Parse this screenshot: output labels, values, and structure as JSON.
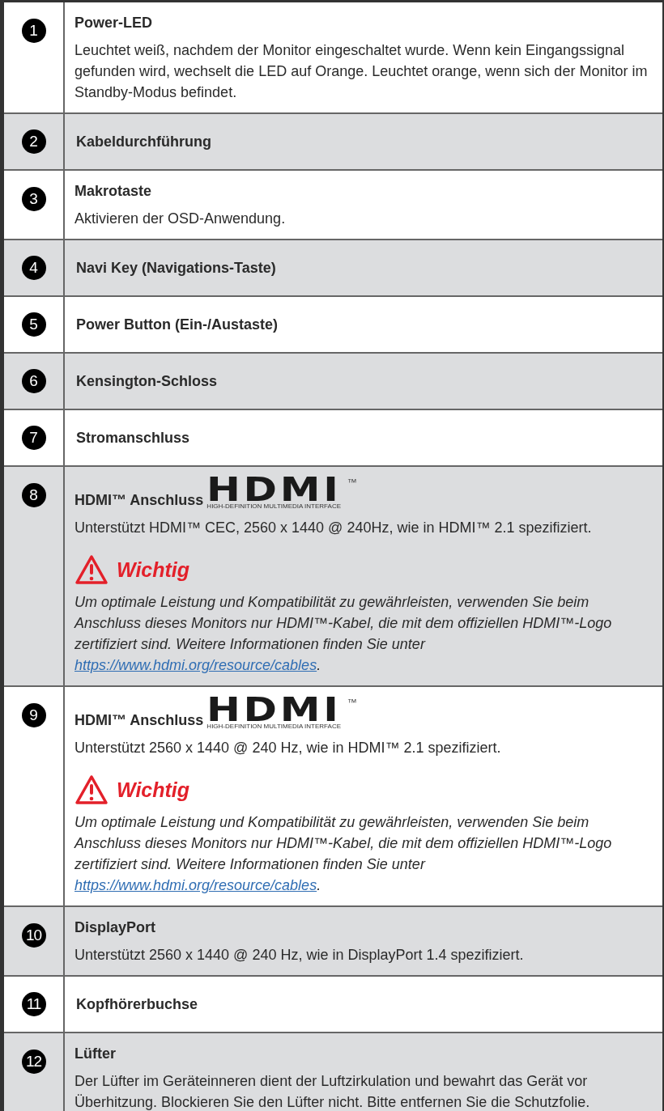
{
  "rows": [
    {
      "number": "1",
      "title": "Power-LED",
      "text": "Leuchtet weiß, nachdem der Monitor eingeschaltet wurde. Wenn kein Eingangssignal gefunden wird, wechselt die LED auf Orange. Leuchtet orange, wenn sich der Monitor im Standby-Modus befindet."
    },
    {
      "number": "2",
      "title": "Kabeldurchführung"
    },
    {
      "number": "3",
      "title": "Makrotaste",
      "text": "Aktivieren der OSD-Anwendung."
    },
    {
      "number": "4",
      "title": "Navi Key (Navigations-Taste)"
    },
    {
      "number": "5",
      "title": "Power Button (Ein-/Austaste)"
    },
    {
      "number": "6",
      "title": "Kensington-Schloss"
    },
    {
      "number": "7",
      "title": "Stromanschluss"
    },
    {
      "number": "8",
      "title": "HDMI™ Anschluss",
      "logo": {
        "wordmark": "HDMI",
        "tm": "™",
        "tagline": "HIGH-DEFINITION MULTIMEDIA INTERFACE"
      },
      "text": "Unterstützt HDMI™ CEC, 2560 x 1440 @ 240Hz, wie in HDMI™ 2.1 spezifiziert.",
      "note": {
        "title": "Wichtig",
        "text": "Um optimale Leistung und Kompatibilität zu gewährleisten, verwenden Sie beim Anschluss dieses Monitors nur HDMI™-Kabel, die mit dem offiziellen HDMI™-Logo zertifiziert sind. Weitere Informationen finden Sie unter",
        "link": "https://www.hdmi.org/resource/cables",
        "after": "."
      }
    },
    {
      "number": "9",
      "title": "HDMI™ Anschluss",
      "logo": {
        "wordmark": "HDMI",
        "tm": "™",
        "tagline": "HIGH-DEFINITION MULTIMEDIA INTERFACE"
      },
      "text": "Unterstützt 2560 x 1440 @ 240 Hz, wie in HDMI™ 2.1 spezifiziert.",
      "note": {
        "title": "Wichtig",
        "text": "Um optimale Leistung und Kompatibilität zu gewährleisten, verwenden Sie beim Anschluss dieses Monitors nur HDMI™-Kabel, die mit dem offiziellen HDMI™-Logo zertifiziert sind. Weitere Informationen finden Sie unter",
        "link": "https://www.hdmi.org/resource/cables",
        "after": "."
      }
    },
    {
      "number": "10",
      "title": "DisplayPort",
      "text": "Unterstützt 2560 x 1440 @ 240 Hz, wie in DisplayPort 1.4 spezifiziert."
    },
    {
      "number": "11",
      "title": "Kopfhörerbuchse"
    },
    {
      "number": "12",
      "title": "Lüfter",
      "text": "Der Lüfter im Geräteinneren dient der Luftzirkulation und bewahrt das Gerät vor Überhitzung. Blockieren Sie den Lüfter nicht. Bitte entfernen Sie die Schutzfolie."
    }
  ]
}
